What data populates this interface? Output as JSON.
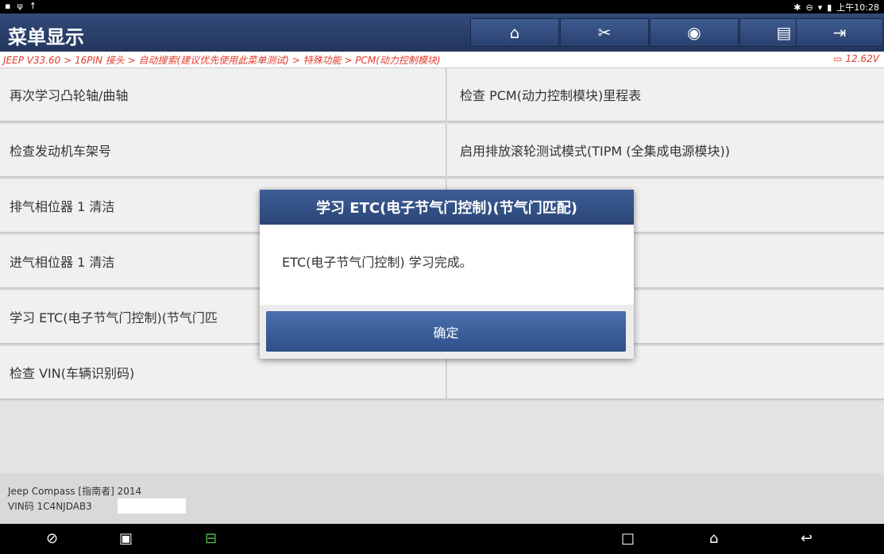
{
  "status": {
    "time": "上午10:28"
  },
  "header": {
    "title": "菜单显示",
    "icons": [
      "home-icon",
      "tools-icon",
      "user-icon",
      "print-icon",
      "exit-icon"
    ]
  },
  "breadcrumb": {
    "path": "JEEP V33.60 > 16PIN 接头 > 自动搜索(建议优先使用此菜单测试) > 特殊功能 > PCM(动力控制模块)",
    "voltage": "12.62V"
  },
  "menu": {
    "left": [
      "再次学习凸轮轴/曲轴",
      "检查发动机车架号",
      "排气相位器 1 清洁",
      "进气相位器 1 清洁",
      "学习 ETC(电子节气门控制)(节气门匹",
      "检查 VIN(车辆识别码)"
    ],
    "right": [
      "检查 PCM(动力控制模块)里程表",
      "启用排放滚轮测试模式(TIPM (全集成电源模块))"
    ]
  },
  "footer": {
    "vehicle": "Jeep Compass [指南者] 2014",
    "vin": "VIN码 1C4NJDAB3"
  },
  "dialog": {
    "title": "学习 ETC(电子节气门控制)(节气门匹配)",
    "message": "ETC(电子节气门控制) 学习完成。",
    "ok_label": "确定"
  },
  "colors": {
    "header": "#2b4677",
    "accent": "#e03a2a"
  }
}
